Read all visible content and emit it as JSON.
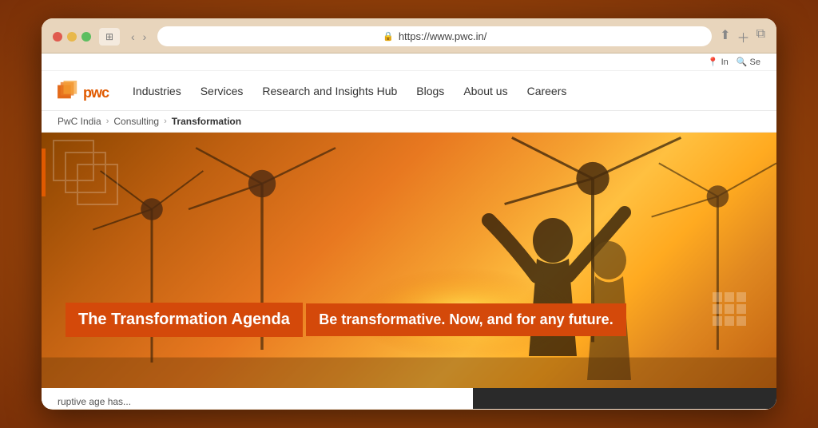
{
  "browser": {
    "url": "https://www.pwc.in/",
    "tab_icon": "⊞",
    "back_btn": "‹",
    "forward_btn": "›",
    "lock_icon": "🔒"
  },
  "topbar": {
    "location_label": "In",
    "search_label": "Se"
  },
  "nav": {
    "logo_text": "pwc",
    "links": [
      {
        "label": "Industries",
        "id": "industries"
      },
      {
        "label": "Services",
        "id": "services"
      },
      {
        "label": "Research and Insights Hub",
        "id": "research"
      },
      {
        "label": "Blogs",
        "id": "blogs"
      },
      {
        "label": "About us",
        "id": "about"
      },
      {
        "label": "Careers",
        "id": "careers"
      }
    ]
  },
  "breadcrumb": {
    "items": [
      {
        "label": "PwC India",
        "active": false
      },
      {
        "label": "Consulting",
        "active": false
      },
      {
        "label": "Transformation",
        "active": true
      }
    ]
  },
  "hero": {
    "title": "The Transformation Agenda",
    "subtitle": "Be transformative. Now, and for any future."
  },
  "bottom_preview": {
    "left_text": "ruptive age has...",
    "colors": {
      "accent": "#d4490a",
      "dark": "#2a2a2a"
    }
  }
}
